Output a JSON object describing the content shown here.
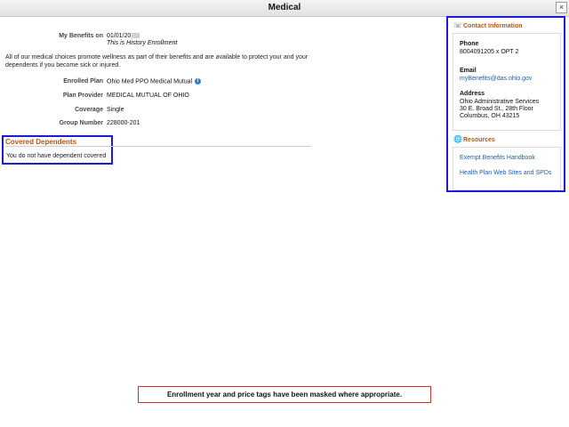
{
  "window": {
    "title": "Medical",
    "close_label": "×"
  },
  "benefits": {
    "label": "My Benefits on",
    "date": "01/01/20",
    "history_note": "This is History Enrollment",
    "intro": "All of our medical choices promote wellness as part of their benefits and are available to protect your and your dependents if you become sick or injured."
  },
  "details": [
    {
      "label": "Enrolled Plan",
      "value": "Ohio Med PPO Medical Mutual"
    },
    {
      "label": "Plan Provider",
      "value": "MEDICAL MUTUAL OF OHIO"
    },
    {
      "label": "Coverage",
      "value": "Single"
    },
    {
      "label": "Group Number",
      "value": "228000-201"
    }
  ],
  "info_icon": "info-icon",
  "covered": {
    "title": "Covered Dependents",
    "text": "You do not have dependent covered"
  },
  "contact": {
    "title": "Contact Information",
    "icon": "phone-icon",
    "phone_label": "Phone",
    "phone_value": "8004091205 x OPT 2",
    "email_label": "Email",
    "email_value": "myBenefits@das.ohio.gov",
    "address_label": "Address",
    "address_lines": [
      "Ohio Administrative Services",
      "30 E. Broad St., 28th Floor",
      "Columbus, OH 43215"
    ]
  },
  "resources": {
    "title": "Resources",
    "icon": "globe-icon",
    "links": [
      "Exempt Benefits Handbook",
      "Health Plan Web Sites and SPDs"
    ]
  },
  "notice": "Enrollment year and price tags have been masked where appropriate.",
  "colors": {
    "highlight_border": "#1a1ad8",
    "section_title": "#b8550f",
    "link": "#1f5fb0",
    "notice_border": "#d03030"
  }
}
